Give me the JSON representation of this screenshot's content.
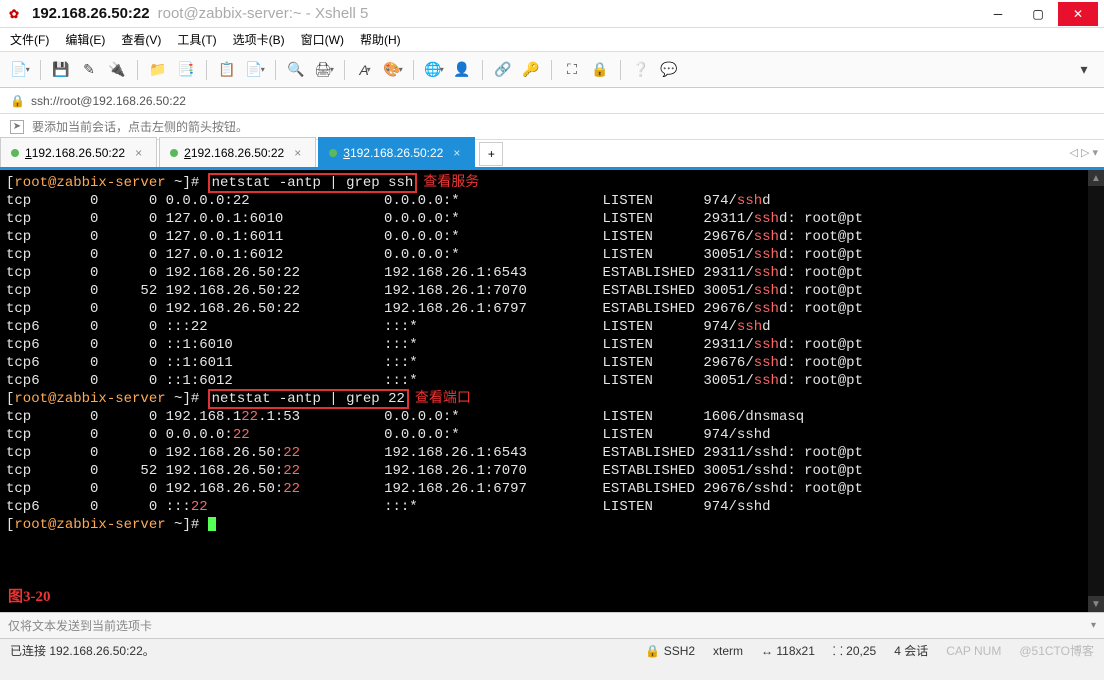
{
  "title": {
    "ip": "192.168.26.50:22",
    "sub": "root@zabbix-server:~ - Xshell 5"
  },
  "menu": {
    "file": "文件(F)",
    "edit": "编辑(E)",
    "view": "查看(V)",
    "tools": "工具(T)",
    "tabs": "选项卡(B)",
    "window": "窗口(W)",
    "help": "帮助(H)"
  },
  "addr": {
    "url": "ssh://root@192.168.26.50:22"
  },
  "hint": {
    "text": "要添加当前会话，点击左侧的箭头按钮。"
  },
  "tabs": {
    "items": [
      {
        "idx": "1",
        "label": "192.168.26.50:22"
      },
      {
        "idx": "2",
        "label": "192.168.26.50:22"
      },
      {
        "idx": "3",
        "label": "192.168.26.50:22"
      }
    ]
  },
  "term": {
    "prompt_user": "root@zabbix-server",
    "prompt_path": "~",
    "cmd1": "netstat -antp | grep ssh",
    "cmd1_label": "查看服务",
    "cmd2": "netstat -antp | grep 22",
    "cmd2_label": "查看端口",
    "rows1": [
      {
        "p": "tcp",
        "r": "0",
        "s": "0",
        "l": "0.0.0.0:22",
        "f": "0.0.0.0:*",
        "st": "LISTEN",
        "pid": "974/",
        "prog": "ssh",
        "prog2": "d",
        "extra": ""
      },
      {
        "p": "tcp",
        "r": "0",
        "s": "0",
        "l": "127.0.0.1:6010",
        "f": "0.0.0.0:*",
        "st": "LISTEN",
        "pid": "29311/",
        "prog": "ssh",
        "prog2": "d:",
        "extra": " root@pt"
      },
      {
        "p": "tcp",
        "r": "0",
        "s": "0",
        "l": "127.0.0.1:6011",
        "f": "0.0.0.0:*",
        "st": "LISTEN",
        "pid": "29676/",
        "prog": "ssh",
        "prog2": "d:",
        "extra": " root@pt"
      },
      {
        "p": "tcp",
        "r": "0",
        "s": "0",
        "l": "127.0.0.1:6012",
        "f": "0.0.0.0:*",
        "st": "LISTEN",
        "pid": "30051/",
        "prog": "ssh",
        "prog2": "d:",
        "extra": " root@pt"
      },
      {
        "p": "tcp",
        "r": "0",
        "s": "0",
        "l": "192.168.26.50:22",
        "f": "192.168.26.1:6543",
        "st": "ESTABLISHED",
        "pid": "29311/",
        "prog": "ssh",
        "prog2": "d:",
        "extra": " root@pt"
      },
      {
        "p": "tcp",
        "r": "0",
        "s": "52",
        "l": "192.168.26.50:22",
        "f": "192.168.26.1:7070",
        "st": "ESTABLISHED",
        "pid": "30051/",
        "prog": "ssh",
        "prog2": "d:",
        "extra": " root@pt"
      },
      {
        "p": "tcp",
        "r": "0",
        "s": "0",
        "l": "192.168.26.50:22",
        "f": "192.168.26.1:6797",
        "st": "ESTABLISHED",
        "pid": "29676/",
        "prog": "ssh",
        "prog2": "d:",
        "extra": " root@pt"
      },
      {
        "p": "tcp6",
        "r": "0",
        "s": "0",
        "l": ":::22",
        "f": ":::*",
        "st": "LISTEN",
        "pid": "974/",
        "prog": "ssh",
        "prog2": "d",
        "extra": ""
      },
      {
        "p": "tcp6",
        "r": "0",
        "s": "0",
        "l": "::1:6010",
        "f": ":::*",
        "st": "LISTEN",
        "pid": "29311/",
        "prog": "ssh",
        "prog2": "d:",
        "extra": " root@pt"
      },
      {
        "p": "tcp6",
        "r": "0",
        "s": "0",
        "l": "::1:6011",
        "f": ":::*",
        "st": "LISTEN",
        "pid": "29676/",
        "prog": "ssh",
        "prog2": "d:",
        "extra": " root@pt"
      },
      {
        "p": "tcp6",
        "r": "0",
        "s": "0",
        "l": "::1:6012",
        "f": ":::*",
        "st": "LISTEN",
        "pid": "30051/",
        "prog": "ssh",
        "prog2": "d:",
        "extra": " root@pt"
      }
    ],
    "rows2": [
      {
        "p": "tcp",
        "r": "0",
        "s": "0",
        "l": "192.168.1",
        "lhl": "22",
        "lpost": ".1:53",
        "f": "0.0.0.0:*",
        "st": "LISTEN",
        "pid": "1606/dnsmasq",
        "extra": ""
      },
      {
        "p": "tcp",
        "r": "0",
        "s": "0",
        "l": "0.0.0.0:",
        "lhl": "22",
        "lpost": "",
        "f": "0.0.0.0:*",
        "st": "LISTEN",
        "pid": "974/sshd",
        "extra": ""
      },
      {
        "p": "tcp",
        "r": "0",
        "s": "0",
        "l": "192.168.26.50:",
        "lhl": "22",
        "lpost": "",
        "f": "192.168.26.1:6543",
        "st": "ESTABLISHED",
        "pid": "29311/sshd:",
        "extra": " root@pt"
      },
      {
        "p": "tcp",
        "r": "0",
        "s": "52",
        "l": "192.168.26.50:",
        "lhl": "22",
        "lpost": "",
        "f": "192.168.26.1:7070",
        "st": "ESTABLISHED",
        "pid": "30051/sshd:",
        "extra": " root@pt"
      },
      {
        "p": "tcp",
        "r": "0",
        "s": "0",
        "l": "192.168.26.50:",
        "lhl": "22",
        "lpost": "",
        "f": "192.168.26.1:6797",
        "st": "ESTABLISHED",
        "pid": "29676/sshd:",
        "extra": " root@pt"
      },
      {
        "p": "tcp6",
        "r": "0",
        "s": "0",
        "l": ":::",
        "lhl": "22",
        "lpost": "",
        "f": ":::*",
        "st": "LISTEN",
        "pid": "974/sshd",
        "extra": ""
      }
    ],
    "figlabel": "图3-20"
  },
  "send": {
    "text": "仅将文本发送到当前选项卡"
  },
  "status": {
    "conn": "已连接 192.168.26.50:22。",
    "proto": "SSH2",
    "term": "xterm",
    "size": "118x21",
    "pos": "20,25",
    "sess": "4 会话",
    "watermark": "@51CTO博客"
  }
}
